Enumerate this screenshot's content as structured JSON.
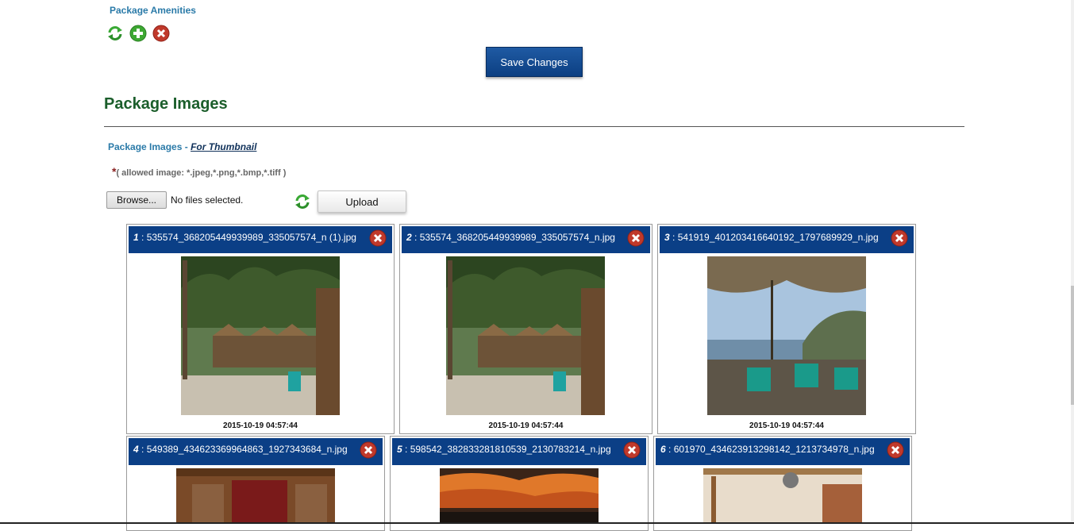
{
  "amenities": {
    "title": "Package Amenities",
    "icons": [
      "refresh-icon",
      "add-icon",
      "delete-icon"
    ]
  },
  "save_label": "Save Changes",
  "images_section": {
    "title": "Package Images",
    "label": "Package Images",
    "separator": " - ",
    "thumb_link": "For Thumbnail",
    "required_mark": "*",
    "allowed": "( allowed image: *.jpeg,*.png,*.bmp,*.tiff )",
    "browse_label": "Browse...",
    "no_file": "No files selected.",
    "upload_label": "Upload"
  },
  "images": [
    {
      "num": "1",
      "name": " : 535574_368205449939989_335057574_n (1).jpg",
      "date": "2015-10-19 04:57:44"
    },
    {
      "num": "2",
      "name": " : 535574_368205449939989_335057574_n.jpg",
      "date": "2015-10-19 04:57:44"
    },
    {
      "num": "3",
      "name": " : 541919_401203416640192_1797689929_n.jpg",
      "date": "2015-10-19 04:57:44"
    },
    {
      "num": "4",
      "name": " : 549389_434623369964863_1927343684_n.jpg",
      "date": ""
    },
    {
      "num": "5",
      "name": " : 598542_382833281810539_2130783214_n.jpg",
      "date": ""
    },
    {
      "num": "6",
      "name": " : 601970_434623913298142_1213734978_n.jpg",
      "date": ""
    }
  ],
  "colors": {
    "header_blue": "#0b3f86",
    "link_blue": "#2a7aa8",
    "title_green": "#1b5e2b",
    "delete_red": "#c0392b"
  }
}
